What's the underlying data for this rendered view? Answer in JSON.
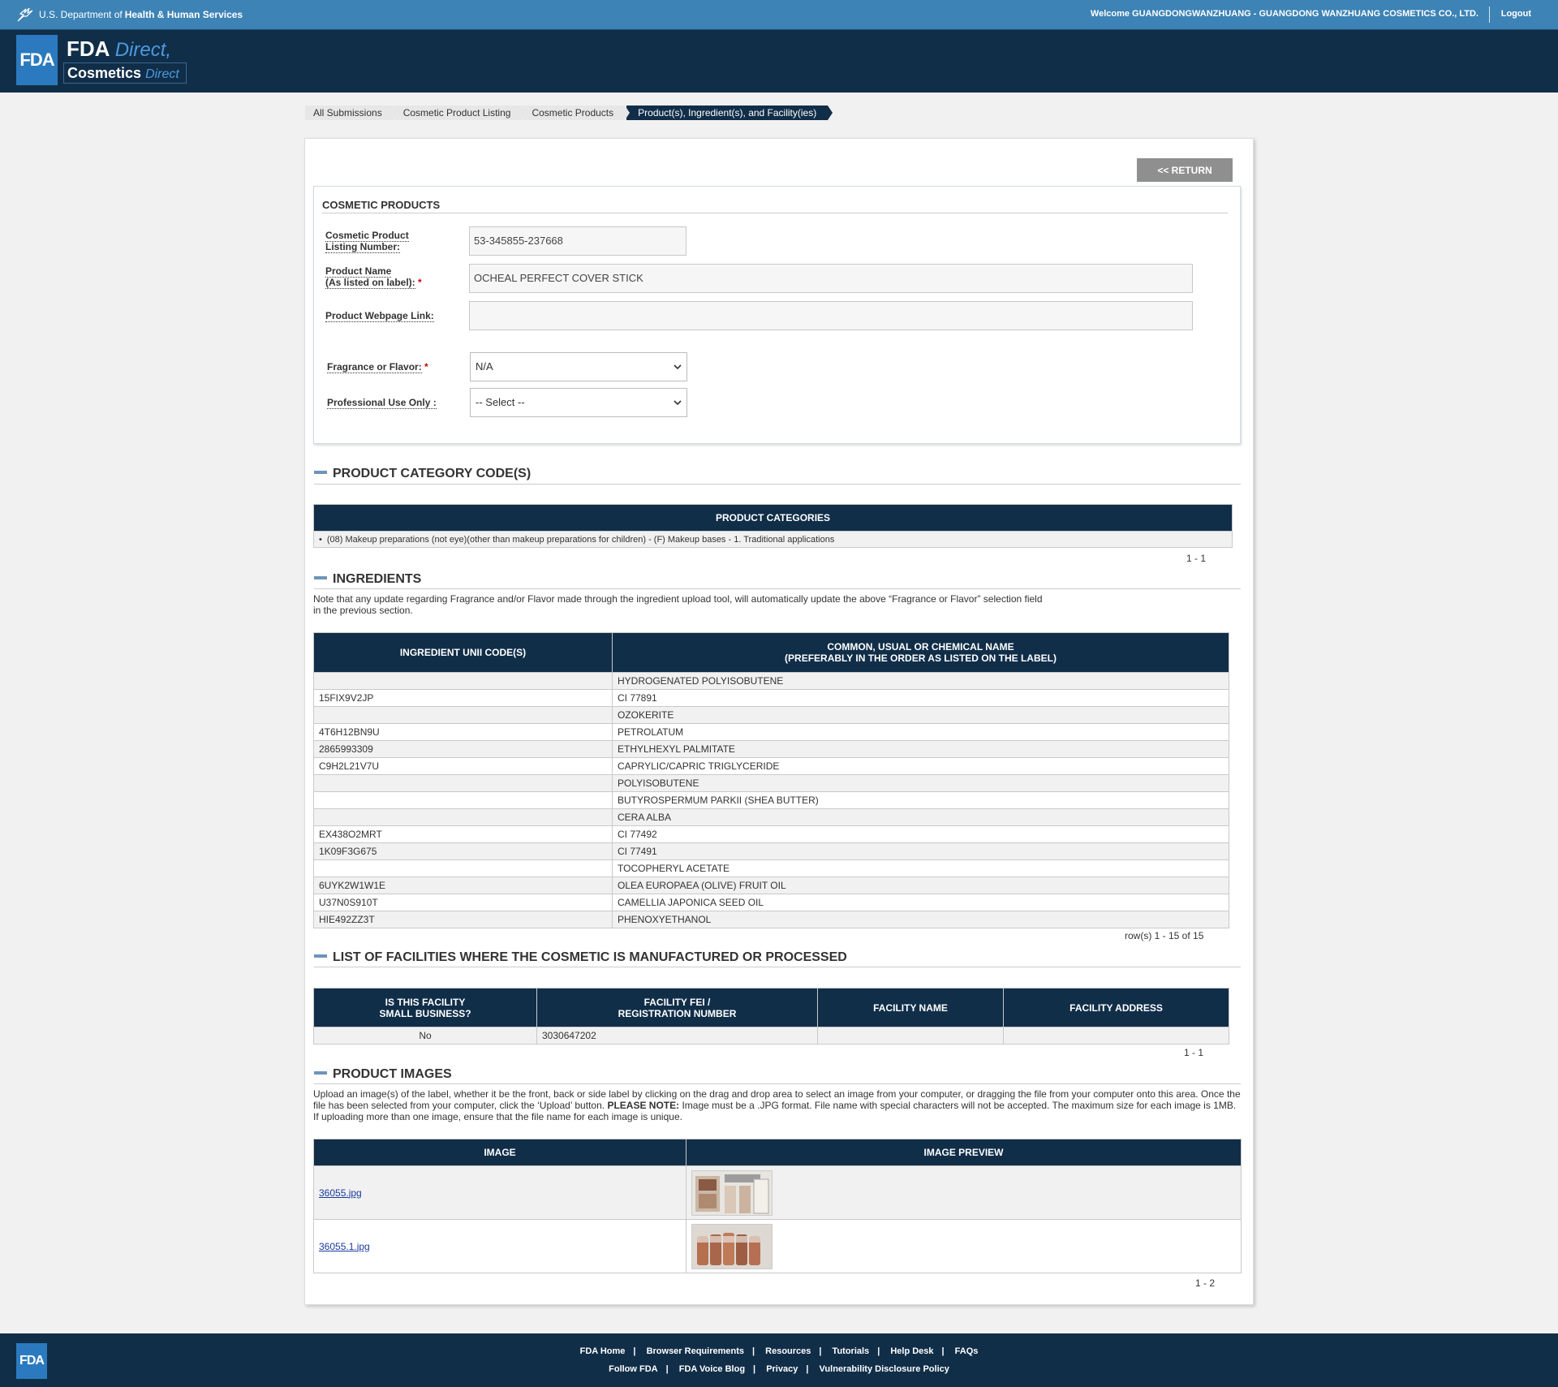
{
  "topbar": {
    "hhs_prefix": "U.S. Department of",
    "hhs_bold": "Health & Human Services",
    "welcome": "Welcome GUANGDONGWANZHUANG - GUANGDONG WANZHUANG COSMETICS CO., LTD.",
    "logout": "Logout"
  },
  "header": {
    "logo_text": "FDA",
    "brand_main": "FDA",
    "brand_main_italic": "Direct,",
    "brand_sub": "Cosmetics",
    "brand_sub_italic": "Direct"
  },
  "breadcrumb": [
    "All Submissions",
    "Cosmetic Product Listing",
    "Cosmetic Products",
    "Product(s), Ingredient(s), and Facility(ies)"
  ],
  "return_label": "<< RETURN",
  "cosmetic_products": {
    "title": "COSMETIC PRODUCTS",
    "listing_label_1": "Cosmetic Product",
    "listing_label_2": "Listing Number:",
    "listing_value": "53-345855-237668",
    "name_label_1": "Product Name",
    "name_label_2": "(As listed on label):",
    "name_value": "OCHEAL PERFECT COVER STICK",
    "web_label": "Product Webpage Link:",
    "web_value": "",
    "fragrance_label": "Fragrance or Flavor:",
    "fragrance_value": "N/A",
    "professional_label": "Professional Use Only :",
    "professional_value": "-- Select --",
    "required_mark": "*"
  },
  "category": {
    "title": "PRODUCT CATEGORY CODE(S)",
    "header": "PRODUCT CATEGORIES",
    "items": [
      "(08) Makeup preparations (not eye)(other than makeup preparations for children) - (F) Makeup bases - 1. Traditional applications"
    ],
    "pager": "1 - 1"
  },
  "ingredients": {
    "title": "INGREDIENTS",
    "note_1": "Note that any update regarding Fragrance and/or Flavor made through the ingredient upload tool, will automatically update the above “Fragrance or Flavor” selection field",
    "note_2": "in the previous section.",
    "col1": "INGREDIENT UNII CODE(S)",
    "col2_1": "COMMON, USUAL OR CHEMICAL NAME",
    "col2_2": "(PREFERABLY IN THE ORDER AS LISTED ON THE LABEL)",
    "rows": [
      {
        "code": "",
        "name": "HYDROGENATED POLYISOBUTENE"
      },
      {
        "code": "15FIX9V2JP",
        "name": "CI 77891"
      },
      {
        "code": "",
        "name": "OZOKERITE"
      },
      {
        "code": "4T6H12BN9U",
        "name": "PETROLATUM"
      },
      {
        "code": "2865993309",
        "name": "ETHYLHEXYL PALMITATE"
      },
      {
        "code": "C9H2L21V7U",
        "name": "CAPRYLIC/CAPRIC TRIGLYCERIDE"
      },
      {
        "code": "",
        "name": "POLYISOBUTENE"
      },
      {
        "code": "",
        "name": "BUTYROSPERMUM PARKII (SHEA BUTTER)"
      },
      {
        "code": "",
        "name": "CERA ALBA"
      },
      {
        "code": "EX438O2MRT",
        "name": "CI 77492"
      },
      {
        "code": "1K09F3G675",
        "name": "CI 77491"
      },
      {
        "code": "",
        "name": "TOCOPHERYL ACETATE"
      },
      {
        "code": "6UYK2W1W1E",
        "name": "OLEA EUROPAEA (OLIVE) FRUIT OIL"
      },
      {
        "code": "U37N0S910T",
        "name": "CAMELLIA JAPONICA SEED OIL"
      },
      {
        "code": "HIE492ZZ3T",
        "name": "PHENOXYETHANOL"
      }
    ],
    "pager": "row(s) 1 - 15 of 15"
  },
  "facilities": {
    "title": "LIST OF FACILITIES WHERE THE COSMETIC IS MANUFACTURED OR PROCESSED",
    "col1_1": "IS THIS FACILITY",
    "col1_2": "SMALL BUSINESS?",
    "col2_1": "FACILITY FEI /",
    "col2_2": "REGISTRATION NUMBER",
    "col3": "FACILITY NAME",
    "col4": "FACILITY ADDRESS",
    "rows": [
      {
        "small": "No",
        "fei": "3030647202",
        "name": "",
        "address": ""
      }
    ],
    "pager": "1 - 1"
  },
  "images": {
    "title": "PRODUCT IMAGES",
    "note_1": "Upload an image(s) of the label, whether it be the front, back or side label by clicking on the drag and drop area to select an image from your computer, or dragging the file from your computer onto this area. Once the",
    "note_2a": "file has been selected from your computer, click the ‘Upload’ button.",
    "note_2b": "PLEASE NOTE:",
    "note_2c": "Image must be a .JPG format. File name with special characters will not be accepted. The maximum size for each image is 1MB.",
    "note_3": "If uploading more than one image, ensure that the file name for each image is unique.",
    "col1": "IMAGE",
    "col2": "IMAGE PREVIEW",
    "rows": [
      {
        "file": "36055.jpg"
      },
      {
        "file": "36055.1.jpg"
      }
    ],
    "pager": "1 - 2"
  },
  "footer": {
    "logo_text": "FDA",
    "row1": [
      "FDA Home",
      "Browser Requirements",
      "Resources",
      "Tutorials",
      "Help Desk",
      "FAQs"
    ],
    "row2": [
      "Follow FDA",
      "FDA Voice Blog",
      "Privacy",
      "Vulnerability Disclosure Policy"
    ],
    "separator": "|"
  }
}
